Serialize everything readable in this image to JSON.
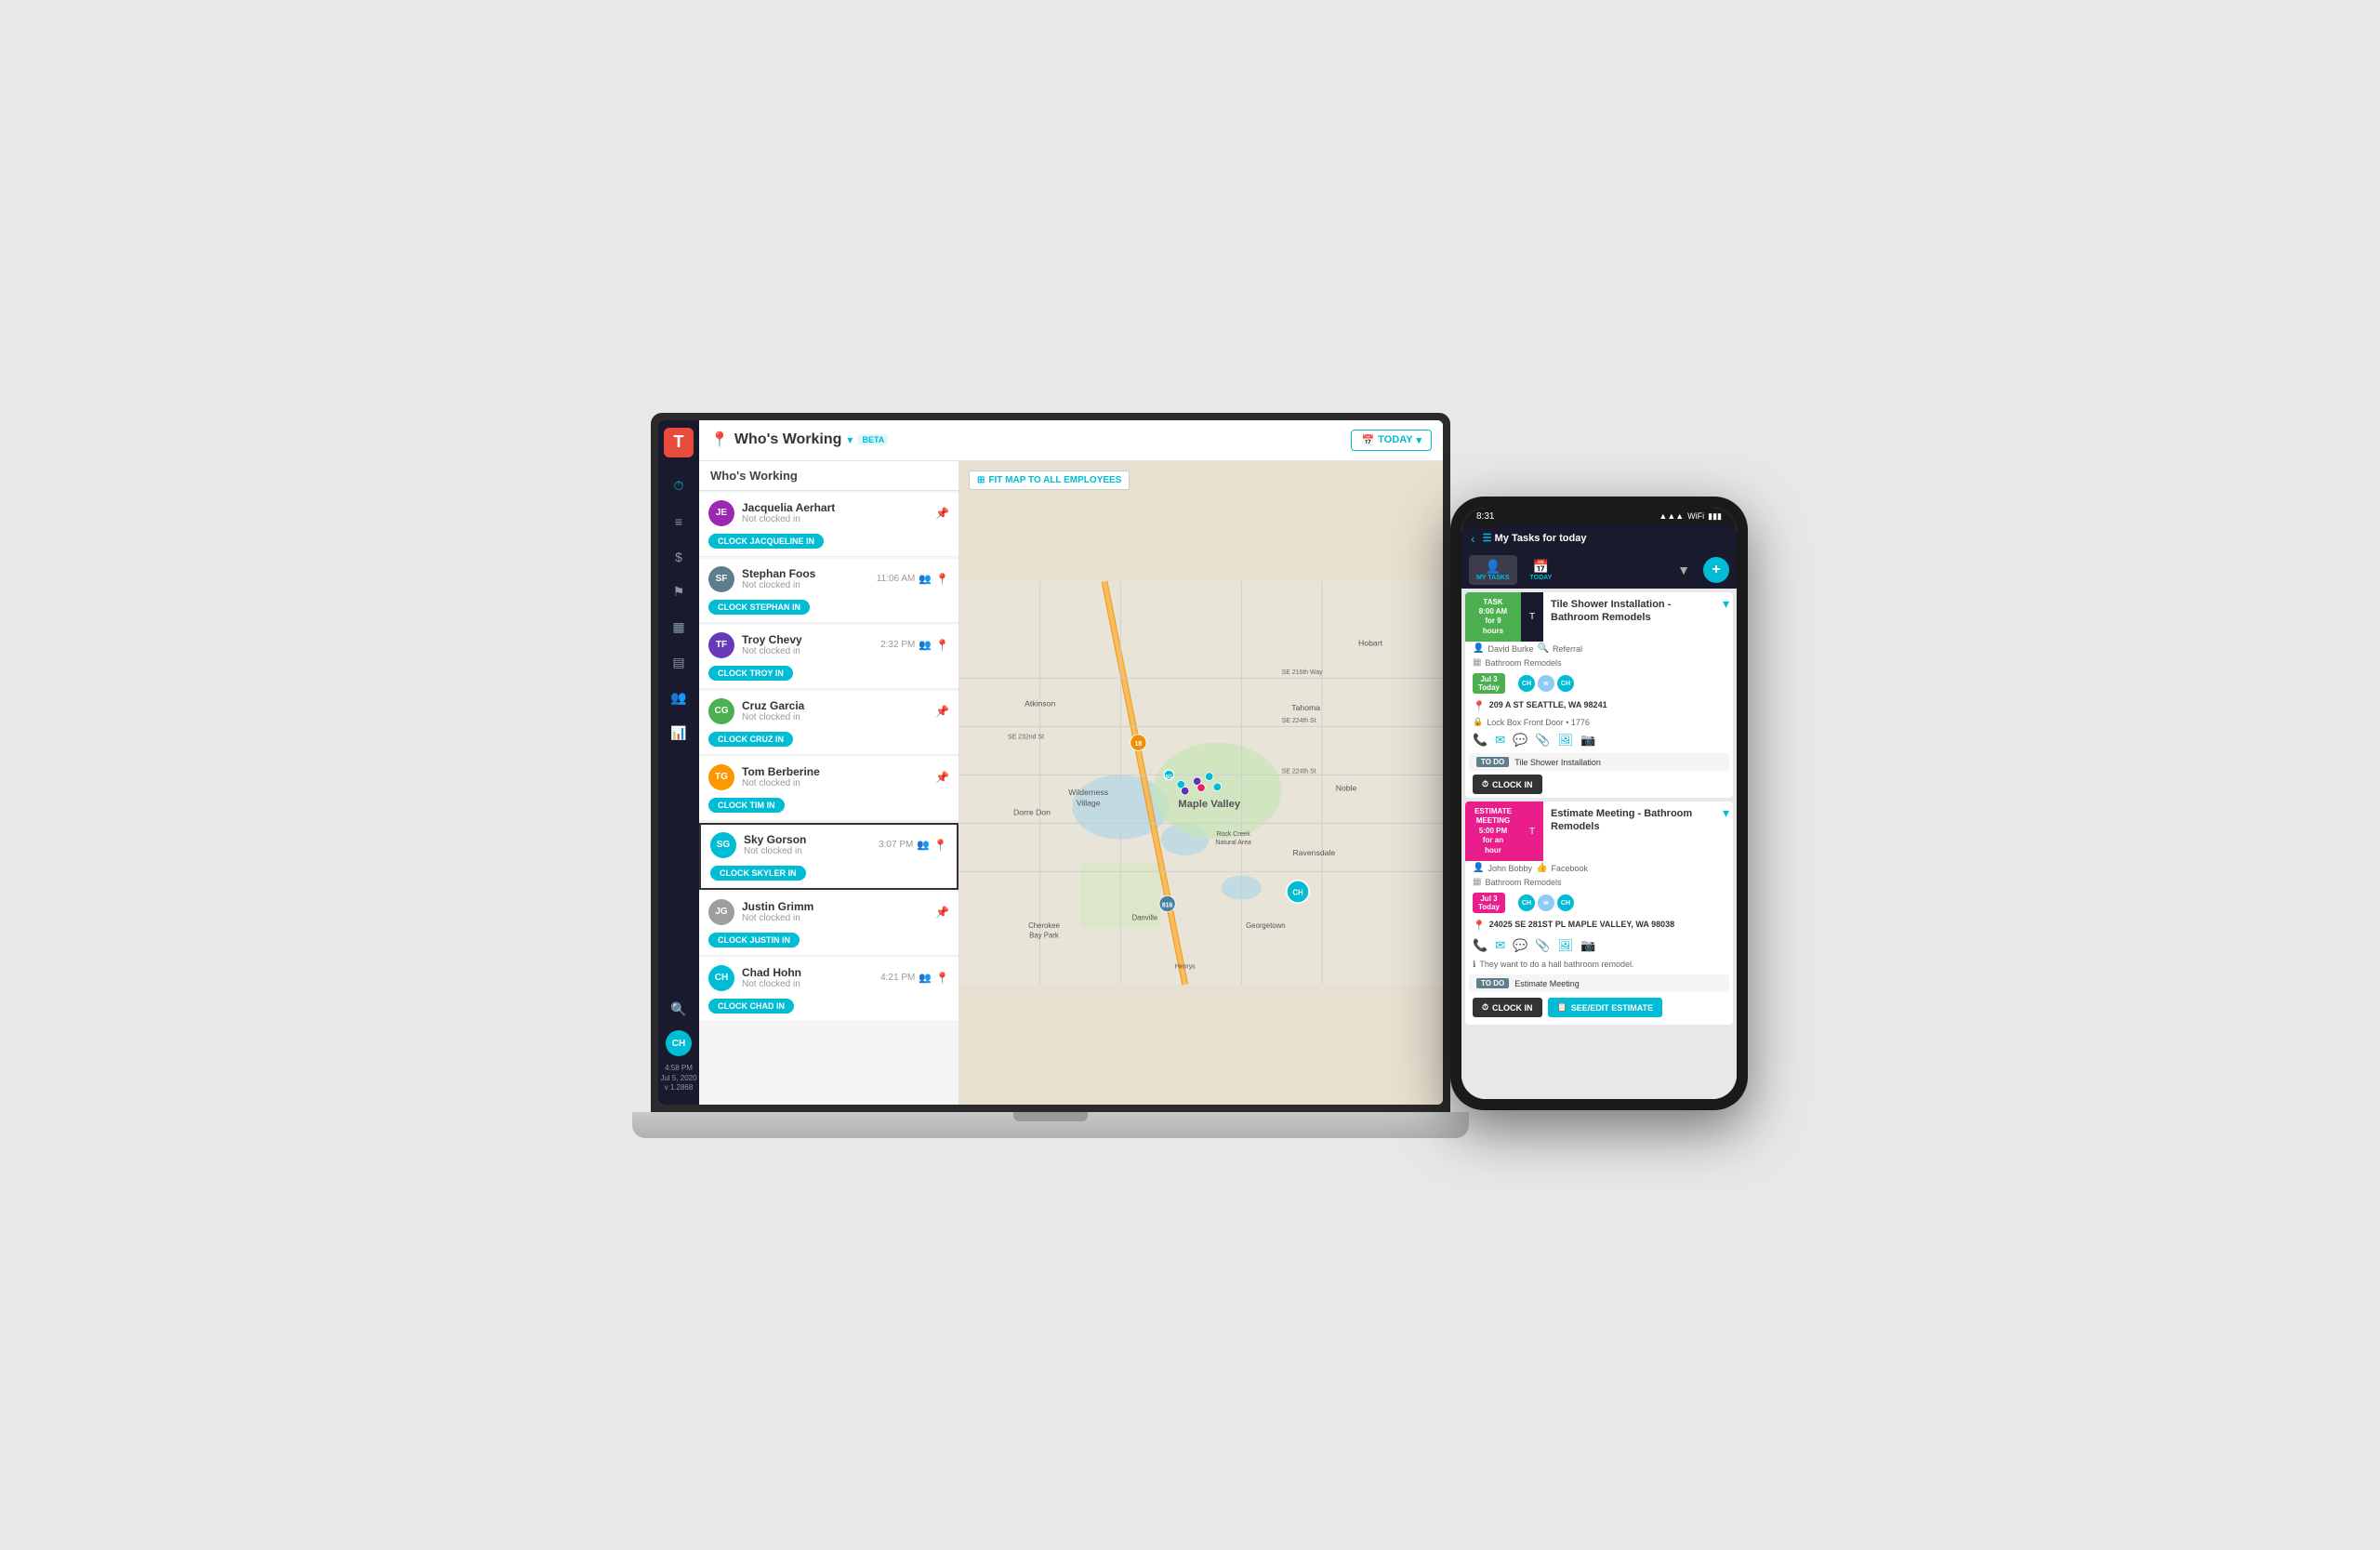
{
  "page": {
    "title": "Who's Working",
    "beta": "BETA",
    "today_label": "TODAY",
    "list_header": "Who's Working",
    "fit_map_label": "FIT MAP TO ALL EMPLOYEES"
  },
  "sidebar": {
    "logo": "T",
    "time": "4:58 PM",
    "date": "Jul 5, 2020",
    "version": "v 1.2868",
    "user_initials": "CH",
    "icons": [
      {
        "name": "clock-icon",
        "symbol": "🕐"
      },
      {
        "name": "list-icon",
        "symbol": "☰"
      },
      {
        "name": "dollar-icon",
        "symbol": "$"
      },
      {
        "name": "flag-icon",
        "symbol": "⚑"
      },
      {
        "name": "calendar-icon",
        "symbol": "📅"
      },
      {
        "name": "gallery-icon",
        "symbol": "▦"
      },
      {
        "name": "people-icon",
        "symbol": "👥"
      },
      {
        "name": "chart-icon",
        "symbol": "📊"
      },
      {
        "name": "search-icon",
        "symbol": "🔍"
      }
    ]
  },
  "employees": [
    {
      "id": "JA",
      "name": "Jacquelia Aerhart",
      "status": "Not clocked in",
      "time": "",
      "location_type": "pin",
      "color": "#9c27b0",
      "clock_btn": "CLOCK JACQUELINE IN",
      "selected": false
    },
    {
      "id": "SF",
      "name": "Stephan Foos",
      "status": "Not clocked in",
      "time": "11:06 AM",
      "location_type": "loc",
      "color": "#607d8b",
      "clock_btn": "CLOCK STEPHAN IN",
      "selected": false
    },
    {
      "id": "TF",
      "name": "Troy Chevy",
      "status": "Not clocked in",
      "time": "2:32 PM",
      "location_type": "loc",
      "color": "#673ab7",
      "clock_btn": "CLOCK TROY IN",
      "selected": false
    },
    {
      "id": "CG",
      "name": "Cruz Garcia",
      "status": "Not clocked in",
      "time": "",
      "location_type": "pin",
      "color": "#4caf50",
      "clock_btn": "CLOCK CRUZ IN",
      "selected": false
    },
    {
      "id": "TG",
      "name": "Tom Berberine",
      "status": "Not clocked in",
      "time": "",
      "location_type": "pin",
      "color": "#ff9800",
      "clock_btn": "CLOCK TIM IN",
      "selected": false
    },
    {
      "id": "SG",
      "name": "Sky Gorson",
      "status": "Not clocked in",
      "time": "3:07 PM",
      "location_type": "loc",
      "color": "#00bcd4",
      "clock_btn": "CLOCK SKYLER IN",
      "selected": true
    },
    {
      "id": "JG",
      "name": "Justin Grimm",
      "status": "Not clocked in",
      "time": "",
      "location_type": "pin",
      "color": "#9e9e9e",
      "clock_btn": "CLOCK JUSTIN IN",
      "selected": false
    },
    {
      "id": "CH",
      "name": "Chad Hohn",
      "status": "Not clocked in",
      "time": "4:21 PM",
      "location_type": "loc",
      "color": "#00bcd4",
      "clock_btn": "CLOCK CHAD IN",
      "selected": false
    }
  ],
  "phone": {
    "status_bar": {
      "time": "8:31",
      "signal": "▲▲▲",
      "wifi": "WiFi",
      "battery": "▮▮▮"
    },
    "nav_title": "My Tasks for today",
    "tabs": [
      {
        "id": "my-tasks",
        "icon": "👤",
        "label": "MY TASKS"
      },
      {
        "id": "today",
        "icon": "📅",
        "label": "TODAY"
      },
      {
        "id": "filter",
        "icon": "▼",
        "label": ""
      },
      {
        "id": "add",
        "icon": "+",
        "label": ""
      }
    ],
    "task1": {
      "label_line1": "TASK",
      "label_line2": "8:00 AM",
      "label_line3": "for 9",
      "label_line4": "hours",
      "label_color": "green",
      "title": "Tile Shower Installation - Bathroom Remodels",
      "assignee": "David Burke",
      "referral": "Referral",
      "business": "Bathroom Remodels",
      "date_line1": "Jul 3",
      "date_line2": "Today",
      "avatars": [
        "CH",
        "w CH"
      ],
      "address": "209 A ST SEATTLE, WA 98241",
      "lock_info": "Lock Box Front Door • 1776",
      "todo_label": "TO DO",
      "todo_text": "Tile Shower Installation",
      "clock_in_label": "CLOCK IN"
    },
    "task2": {
      "label_line1": "ESTIMATE",
      "label_line2": "MEETING",
      "label_line3": "5:00 PM",
      "label_line4": "for an",
      "label_line5": "hour",
      "label_color": "pink",
      "title": "Estimate Meeting - Bathroom Remodels",
      "assignee": "John Bobby",
      "referral": "Facebook",
      "business": "Bathroom Remodels",
      "date_line1": "Jul 3",
      "date_line2": "Today",
      "address": "24025 SE 281ST PL MAPLE VALLEY, WA 98038",
      "note": "They want to do a hall bathroom remodel.",
      "todo_label": "TO DO",
      "todo_text": "Estimate Meeting",
      "clock_in_label": "CLOCK IN",
      "see_edit_label": "SEE/EDIT ESTIMATE"
    }
  }
}
